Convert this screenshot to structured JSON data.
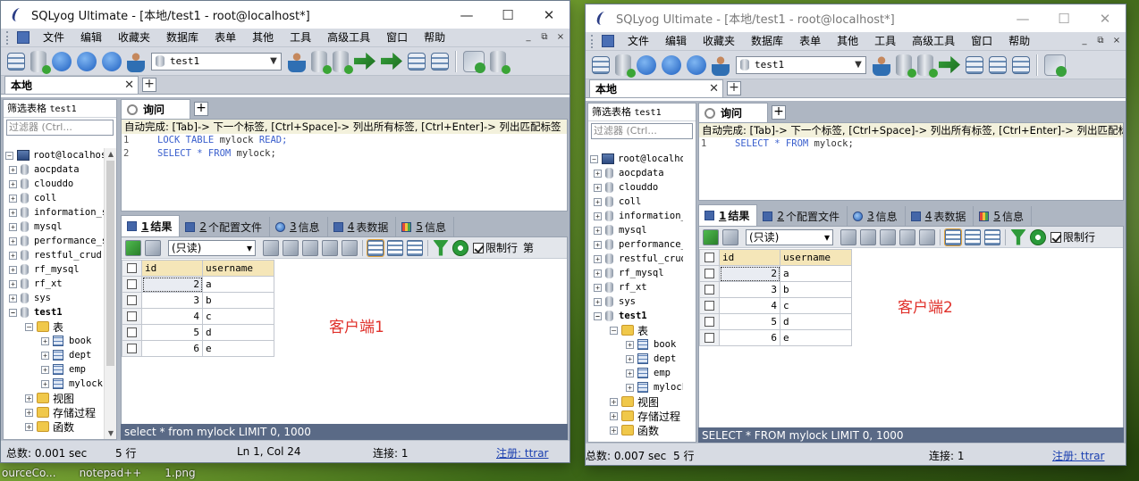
{
  "app": {
    "product": "SQLyog Ultimate",
    "menus": [
      "文件",
      "编辑",
      "收藏夹",
      "数据库",
      "表单",
      "其他",
      "工具",
      "高级工具",
      "窗口",
      "帮助"
    ],
    "mdi_controls": [
      "_",
      "⧉",
      "×"
    ],
    "window_controls": [
      "—",
      "☐",
      "✕"
    ],
    "db_selector": "test1",
    "connection_tab": "本地",
    "query_tab": "询问",
    "filter_label": "筛选表格",
    "filter_db": "test1",
    "filter_placeholder": "过滤器 (Ctrl...",
    "hint": "自动完成: [Tab]-> 下一个标签, [Ctrl+Space]-> 列出所有标签, [Ctrl+Enter]-> 列出匹配标签",
    "result_tabs": [
      {
        "num": "1",
        "label": "结果"
      },
      {
        "num": "2",
        "label": "个配置文件"
      },
      {
        "num": "3",
        "label": "信息"
      },
      {
        "num": "4",
        "label": "表数据"
      },
      {
        "num": "5",
        "label": "信息"
      }
    ],
    "readonly_select": "(只读)",
    "limit_label": "限制行",
    "limit_suffix": "第",
    "columns": [
      "id",
      "username"
    ],
    "rows": [
      {
        "id": "2",
        "username": "a"
      },
      {
        "id": "3",
        "username": "b"
      },
      {
        "id": "4",
        "username": "c"
      },
      {
        "id": "5",
        "username": "d"
      },
      {
        "id": "6",
        "username": "e"
      }
    ],
    "tree": {
      "root": "root@localhost",
      "databases": [
        "aocpdata",
        "clouddo",
        "coll",
        "information_schema",
        "mysql",
        "performance_schema",
        "restful_crud",
        "rf_mysql",
        "rf_xt",
        "sys"
      ],
      "open_db": "test1",
      "tables_folder": "表",
      "tables": [
        "book",
        "dept",
        "emp",
        "mylock"
      ],
      "views_folder": "视图",
      "procs_folder": "存储过程",
      "funcs_folder": "函数"
    }
  },
  "window1": {
    "title": "SQLyog Ultimate - [本地/test1 - root@localhost*]",
    "line1": "LOCK TABLE mylock READ;",
    "line2": "SELECT * FROM mylock;",
    "client_label": "客户端1",
    "sql_status": "select * from mylock LIMIT 0, 1000",
    "status_total": "总数: 0.001 sec",
    "status_rows": "5 行",
    "status_pos": "Ln 1, Col 24",
    "status_conn": "连接: 1",
    "status_reg": "注册: ttrar"
  },
  "window2": {
    "title": "SQLyog Ultimate - [本地/test1 - root@localhost*]",
    "line1": "SELECT * FROM mylock;",
    "client_label": "客户端2",
    "sql_status": "SELECT * FROM mylock LIMIT 0, 1000",
    "status_total": "总数: 0.007 sec",
    "status_rows": "5 行",
    "status_conn": "连接: 1",
    "status_reg": "注册: ttrar"
  },
  "taskbar": [
    "ourceCo...",
    "notepad++",
    "1.png"
  ]
}
